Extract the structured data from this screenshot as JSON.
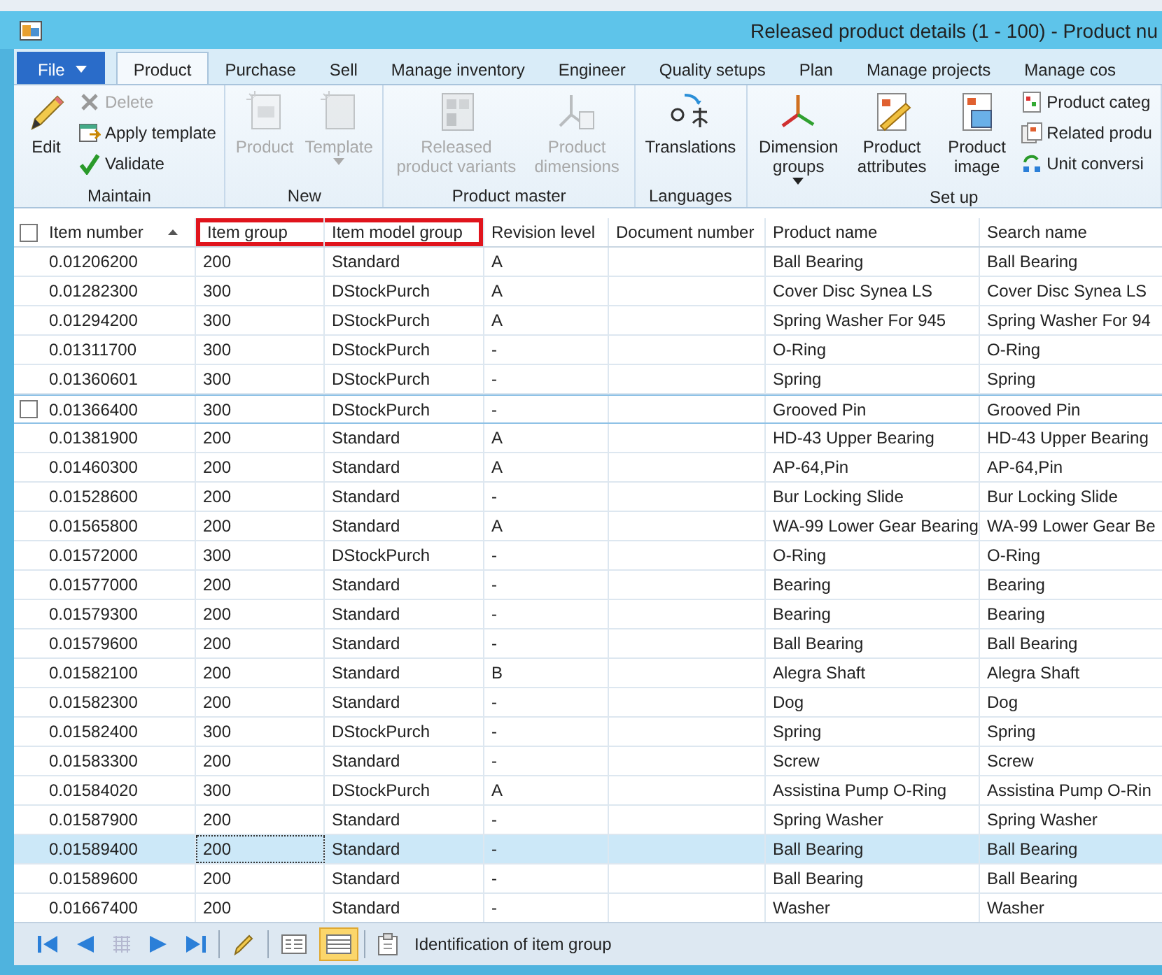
{
  "window": {
    "title": "Released product details (1 - 100) - Product nu"
  },
  "tabs": [
    {
      "label": "File",
      "kind": "file",
      "selected": false
    },
    {
      "label": "Product",
      "kind": "tab",
      "selected": true
    },
    {
      "label": "Purchase",
      "kind": "tab",
      "selected": false
    },
    {
      "label": "Sell",
      "kind": "tab",
      "selected": false
    },
    {
      "label": "Manage inventory",
      "kind": "tab",
      "selected": false
    },
    {
      "label": "Engineer",
      "kind": "tab",
      "selected": false
    },
    {
      "label": "Quality setups",
      "kind": "tab",
      "selected": false
    },
    {
      "label": "Plan",
      "kind": "tab",
      "selected": false
    },
    {
      "label": "Manage projects",
      "kind": "tab",
      "selected": false
    },
    {
      "label": "Manage cos",
      "kind": "tab",
      "selected": false
    }
  ],
  "ribbon": [
    {
      "title": "Maintain",
      "items": [
        {
          "kind": "large",
          "label": "Edit",
          "disabled": false,
          "dropdown": false
        },
        {
          "kind": "small",
          "label": "Delete",
          "disabled": true,
          "dropdown": false
        },
        {
          "kind": "small",
          "label": "Apply template",
          "disabled": false,
          "dropdown": false
        },
        {
          "kind": "small",
          "label": "Validate",
          "disabled": false,
          "dropdown": false
        }
      ]
    },
    {
      "title": "New",
      "items": [
        {
          "kind": "large",
          "label": "Product",
          "disabled": true,
          "dropdown": false
        },
        {
          "kind": "large",
          "label": "Template",
          "disabled": true,
          "dropdown": true
        }
      ]
    },
    {
      "title": "Product master",
      "items": [
        {
          "kind": "large",
          "label": "Released product variants",
          "disabled": true,
          "dropdown": false
        },
        {
          "kind": "large",
          "label": "Product dimensions",
          "disabled": true,
          "dropdown": false
        }
      ]
    },
    {
      "title": "Languages",
      "items": [
        {
          "kind": "large",
          "label": "Translations",
          "disabled": false,
          "dropdown": false
        }
      ]
    },
    {
      "title": "Set up",
      "items": [
        {
          "kind": "large",
          "label": "Dimension groups",
          "disabled": false,
          "dropdown": true
        },
        {
          "kind": "large",
          "label": "Product attributes",
          "disabled": false,
          "dropdown": false
        },
        {
          "kind": "large",
          "label": "Product image",
          "disabled": false,
          "dropdown": false
        },
        {
          "kind": "small",
          "label": "Product categ",
          "disabled": false,
          "dropdown": false
        },
        {
          "kind": "small",
          "label": "Related produ",
          "disabled": false,
          "dropdown": false
        },
        {
          "kind": "small",
          "label": "Unit conversi",
          "disabled": false,
          "dropdown": false
        }
      ]
    }
  ],
  "table": {
    "select_all": {
      "checked": false
    },
    "columns": [
      {
        "label": "Item number",
        "sorted": true,
        "highlighted": false,
        "focused": false
      },
      {
        "label": "Item group",
        "sorted": false,
        "highlighted": true,
        "focused": true
      },
      {
        "label": "Item model group",
        "sorted": false,
        "highlighted": true,
        "focused": false
      },
      {
        "label": "Revision level",
        "sorted": false,
        "highlighted": false,
        "focused": false
      },
      {
        "label": "Document number",
        "sorted": false,
        "highlighted": false,
        "focused": false
      },
      {
        "label": "Product name",
        "sorted": false,
        "highlighted": false,
        "focused": false
      },
      {
        "label": "Search name",
        "sorted": false,
        "highlighted": false,
        "focused": false
      }
    ],
    "rows": [
      {
        "selected": false,
        "hovered": false,
        "cells": [
          "0.01206200",
          "200",
          "Standard",
          "A",
          "",
          "Ball Bearing",
          "Ball Bearing"
        ]
      },
      {
        "selected": false,
        "hovered": false,
        "cells": [
          "0.01282300",
          "300",
          "DStockPurch",
          "A",
          "",
          "Cover Disc Synea LS",
          "Cover Disc Synea LS"
        ]
      },
      {
        "selected": false,
        "hovered": false,
        "cells": [
          "0.01294200",
          "300",
          "DStockPurch",
          "A",
          "",
          "Spring Washer For 945",
          "Spring Washer For 94"
        ]
      },
      {
        "selected": false,
        "hovered": false,
        "cells": [
          "0.01311700",
          "300",
          "DStockPurch",
          "-",
          "",
          "O-Ring",
          "O-Ring"
        ]
      },
      {
        "selected": false,
        "hovered": false,
        "cells": [
          "0.01360601",
          "300",
          "DStockPurch",
          "-",
          "",
          "Spring",
          "Spring"
        ]
      },
      {
        "selected": false,
        "hovered": true,
        "cells": [
          "0.01366400",
          "300",
          "DStockPurch",
          "-",
          "",
          "Grooved Pin",
          "Grooved Pin"
        ]
      },
      {
        "selected": false,
        "hovered": false,
        "cells": [
          "0.01381900",
          "200",
          "Standard",
          "A",
          "",
          "HD-43 Upper Bearing",
          "HD-43 Upper Bearing"
        ]
      },
      {
        "selected": false,
        "hovered": false,
        "cells": [
          "0.01460300",
          "200",
          "Standard",
          "A",
          "",
          "AP-64,Pin",
          "AP-64,Pin"
        ]
      },
      {
        "selected": false,
        "hovered": false,
        "cells": [
          "0.01528600",
          "200",
          "Standard",
          "-",
          "",
          "Bur Locking Slide",
          "Bur Locking Slide"
        ]
      },
      {
        "selected": false,
        "hovered": false,
        "cells": [
          "0.01565800",
          "200",
          "Standard",
          "A",
          "",
          "WA-99 Lower Gear Bearing",
          "WA-99 Lower Gear Be"
        ]
      },
      {
        "selected": false,
        "hovered": false,
        "cells": [
          "0.01572000",
          "300",
          "DStockPurch",
          "-",
          "",
          "O-Ring",
          "O-Ring"
        ]
      },
      {
        "selected": false,
        "hovered": false,
        "cells": [
          "0.01577000",
          "200",
          "Standard",
          "-",
          "",
          "Bearing",
          "Bearing"
        ]
      },
      {
        "selected": false,
        "hovered": false,
        "cells": [
          "0.01579300",
          "200",
          "Standard",
          "-",
          "",
          "Bearing",
          "Bearing"
        ]
      },
      {
        "selected": false,
        "hovered": false,
        "cells": [
          "0.01579600",
          "200",
          "Standard",
          "-",
          "",
          "Ball Bearing",
          "Ball Bearing"
        ]
      },
      {
        "selected": false,
        "hovered": false,
        "cells": [
          "0.01582100",
          "200",
          "Standard",
          "B",
          "",
          "Alegra Shaft",
          "Alegra Shaft"
        ]
      },
      {
        "selected": false,
        "hovered": false,
        "cells": [
          "0.01582300",
          "200",
          "Standard",
          "-",
          "",
          "Dog",
          "Dog"
        ]
      },
      {
        "selected": false,
        "hovered": false,
        "cells": [
          "0.01582400",
          "300",
          "DStockPurch",
          "-",
          "",
          "Spring",
          "Spring"
        ]
      },
      {
        "selected": false,
        "hovered": false,
        "cells": [
          "0.01583300",
          "200",
          "Standard",
          "-",
          "",
          "Screw",
          "Screw"
        ]
      },
      {
        "selected": false,
        "hovered": false,
        "cells": [
          "0.01584020",
          "300",
          "DStockPurch",
          "A",
          "",
          "Assistina Pump O-Ring",
          "Assistina Pump O-Rin"
        ]
      },
      {
        "selected": false,
        "hovered": false,
        "cells": [
          "0.01587900",
          "200",
          "Standard",
          "-",
          "",
          "Spring Washer",
          "Spring Washer"
        ]
      },
      {
        "selected": true,
        "hovered": false,
        "cells": [
          "0.01589400",
          "200",
          "Standard",
          "-",
          "",
          "Ball Bearing",
          "Ball Bearing"
        ]
      },
      {
        "selected": false,
        "hovered": false,
        "cells": [
          "0.01589600",
          "200",
          "Standard",
          "-",
          "",
          "Ball Bearing",
          "Ball Bearing"
        ]
      },
      {
        "selected": false,
        "hovered": false,
        "cells": [
          "0.01667400",
          "200",
          "Standard",
          "-",
          "",
          "Washer",
          "Washer"
        ]
      }
    ]
  },
  "status_bar": {
    "buttons": [
      {
        "kind": "first",
        "disabled": false
      },
      {
        "kind": "previous",
        "disabled": false
      },
      {
        "kind": "grid",
        "disabled": true
      },
      {
        "kind": "next",
        "disabled": false
      },
      {
        "kind": "last",
        "disabled": false
      },
      {
        "kind": "edit",
        "disabled": false
      },
      {
        "kind": "details-view",
        "selected": false
      },
      {
        "kind": "grid-view",
        "selected": true
      },
      {
        "kind": "attachment",
        "disabled": false
      }
    ],
    "text": "Identification of item group"
  }
}
